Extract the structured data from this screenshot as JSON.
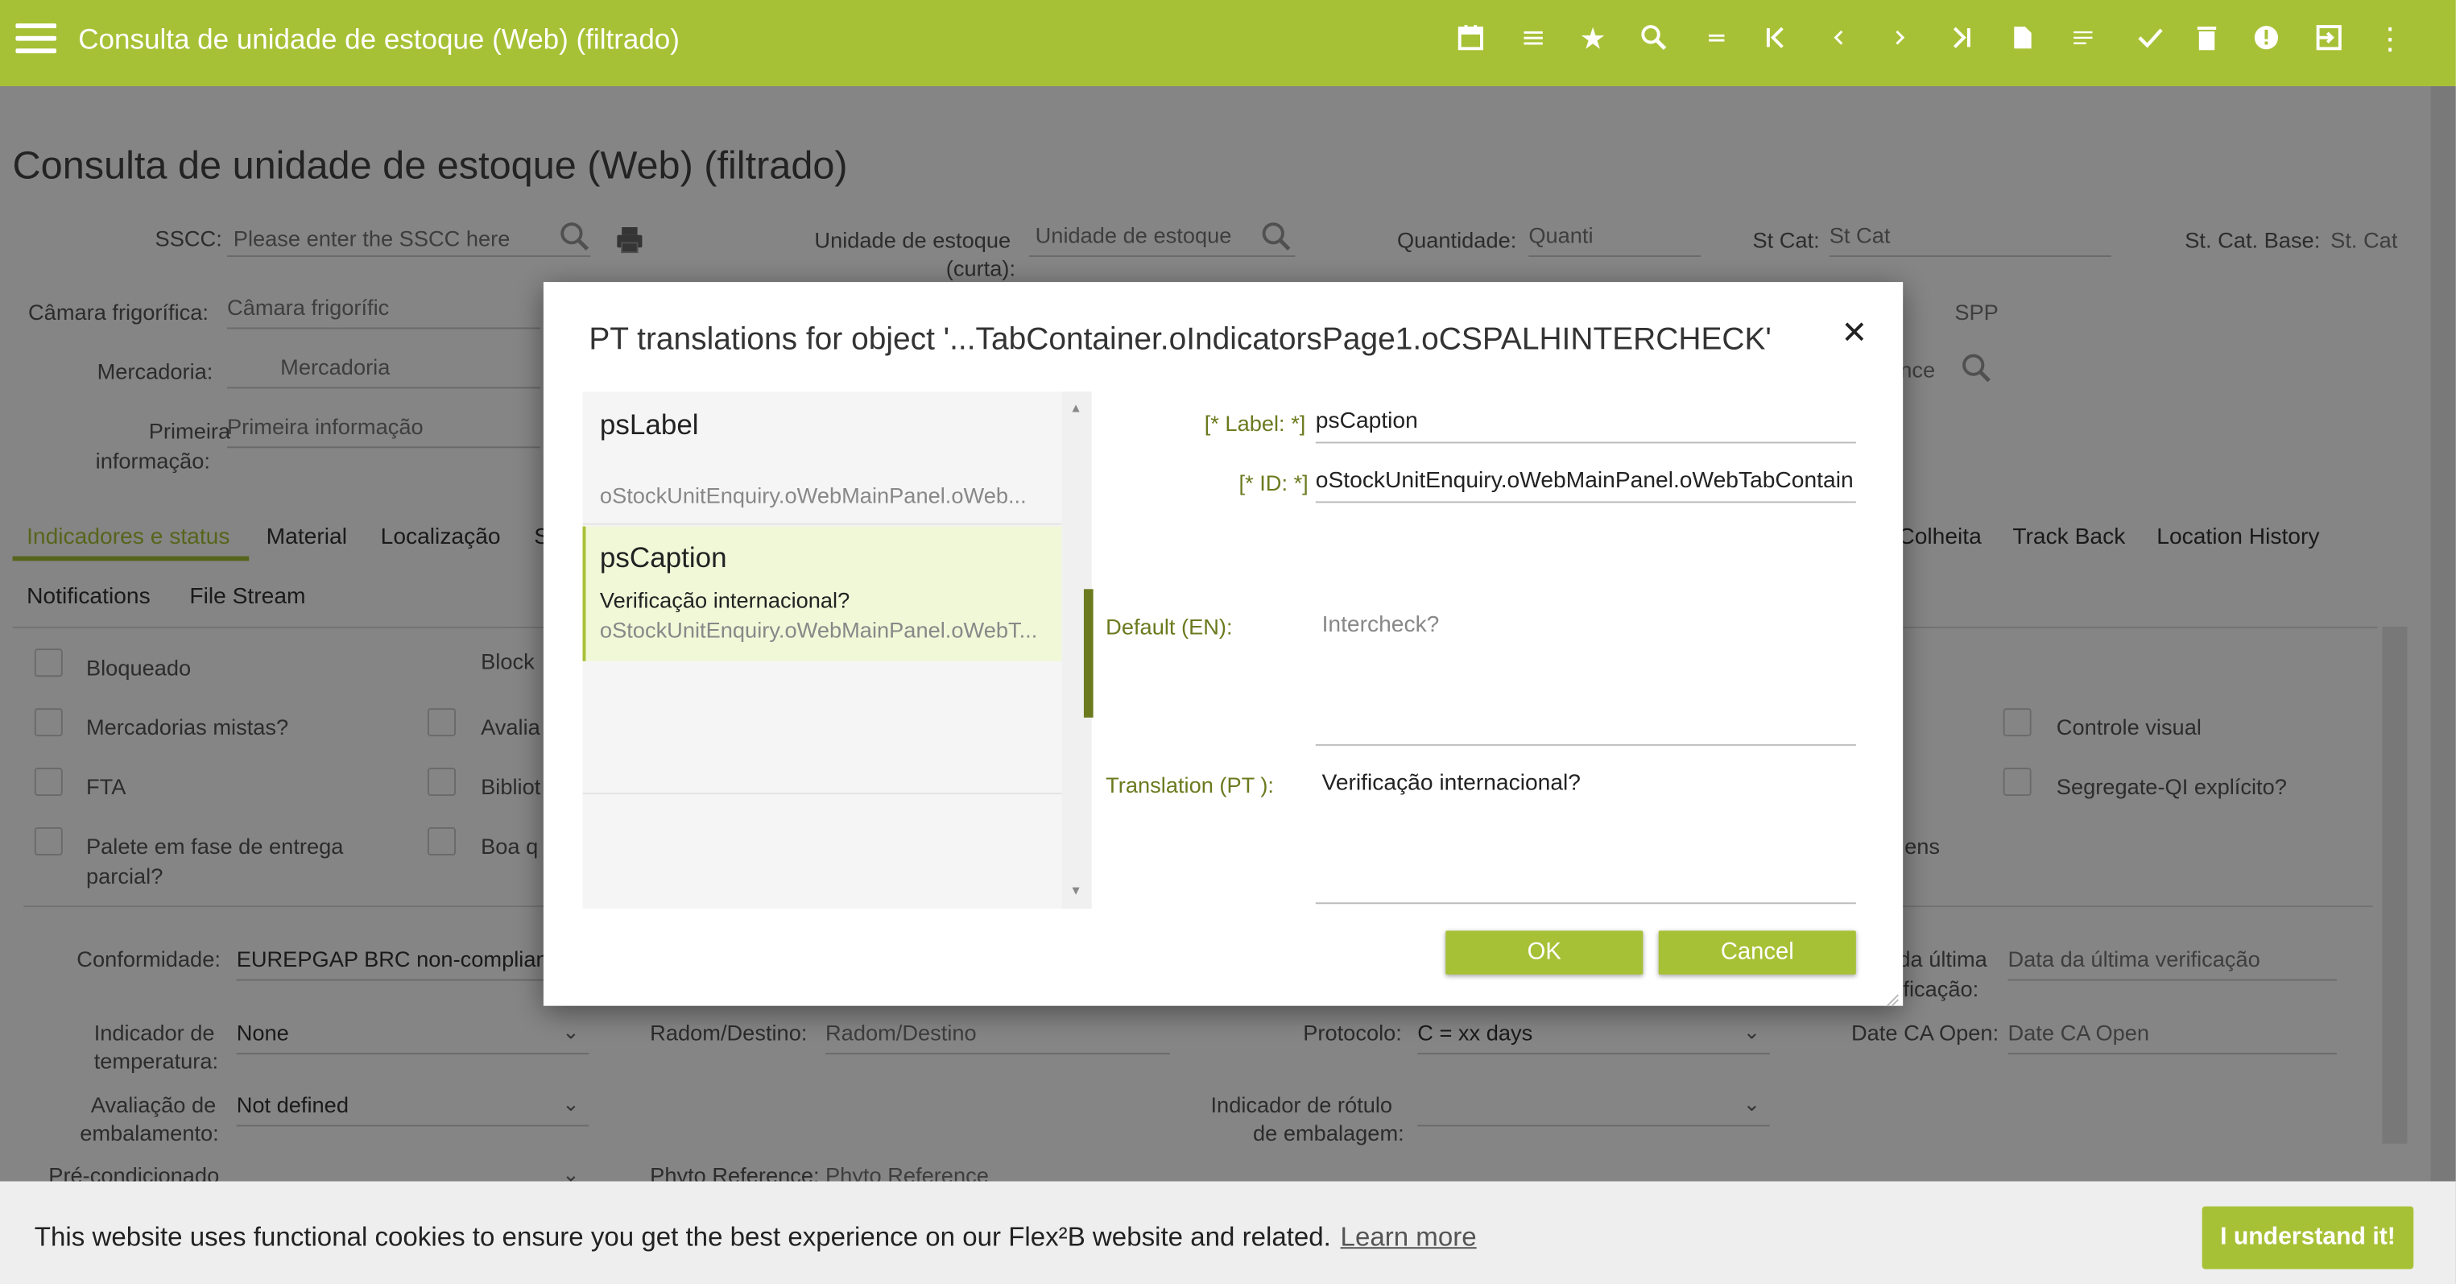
{
  "app": {
    "title": "Consulta de unidade de estoque (Web) (filtrado)"
  },
  "toolbar_icons": [
    "calendar-icon",
    "list-icon",
    "star-icon",
    "search-icon",
    "equals-icon",
    "first-page-icon",
    "prev-icon",
    "next-icon",
    "last-page-icon",
    "new-document-icon",
    "notes-icon",
    "check-icon",
    "delete-icon",
    "info-icon",
    "exit-icon",
    "more-vert-icon"
  ],
  "page": {
    "title": "Consulta de unidade de estoque (Web) (filtrado)",
    "sscc_label": "SSCC:",
    "sscc_placeholder": "Please enter the SSCC here",
    "unidade_label": "Unidade de estoque",
    "unidade_label2": "(curta):",
    "unidade_value": "Unidade de estoque",
    "quantidade_label": "Quantidade:",
    "quantidade_value": "Quanti",
    "stcat_label": "St Cat:",
    "stcat_value": "St Cat",
    "stcatbase_label": "St. Cat. Base:",
    "stcatbase_value": "St. Cat",
    "camara_label": "Câmara frigorífica:",
    "camara_value": "Câmara frigorífic",
    "spp_value": "SPP",
    "mercadoria_label": "Mercadoria:",
    "mercadoria_value": "Mercadoria",
    "nce_value": "nce",
    "primeira_label": "Primeira",
    "primeira_label2": "informação:",
    "primeira_value": "Primeira informação"
  },
  "tabs_row1": [
    "Indicadores e status",
    "Material",
    "Localização",
    "S",
    "Colheita",
    "Track Back",
    "Location History"
  ],
  "tabs_row2": [
    "Notifications",
    "File Stream"
  ],
  "checkboxes": {
    "bloqueado": "Bloqueado",
    "block": "Block",
    "mistas": "Mercadorias mistas?",
    "avalia": "Avalia",
    "controle": "Controle visual",
    "fta": "FTA",
    "bibliot": "Bibliot",
    "segregate": "Segregate-QI explícito?",
    "palete1": "Palete em fase de entrega",
    "palete2": "parcial?",
    "boa": "Boa q",
    "ens": "ens"
  },
  "fields": {
    "conformidade_label": "Conformidade:",
    "conformidade_value": "EUREPGAP BRC non-complian",
    "dataultima_label1": "da última",
    "dataultima_label2": "ificação:",
    "dataultima_value": "Data da última verificação",
    "indtemp_label1": "Indicador de",
    "indtemp_label2": "temperatura:",
    "indtemp_value": "None",
    "radom_label": "Radom/Destino:",
    "radom_value": "Radom/Destino",
    "protocolo_label": "Protocolo:",
    "protocolo_value": "C = xx days",
    "dateca_label": "Date CA Open:",
    "dateca_value": "Date CA Open",
    "avaliacao_label1": "Avaliação de",
    "avaliacao_label2": "embalamento:",
    "avaliacao_value": "Not defined",
    "rotulo_label1": "Indicador de rótulo",
    "rotulo_label2": "de embalagem:",
    "precond_label": "Pré-condicionado",
    "phyto_label": "Phyto Reference:",
    "phyto_value": "Phyto Reference"
  },
  "dialog": {
    "title": "PT translations for object '...TabContainer.oIndicatorsPage1.oCSPALHINTERCHECK'",
    "close_glyph": "✕",
    "items": [
      {
        "name": "psLabel",
        "translation": "",
        "path": "oStockUnitEnquiry.oWebMainPanel.oWeb..."
      },
      {
        "name": "psCaption",
        "translation": "Verificação internacional?",
        "path": "oStockUnitEnquiry.oWebMainPanel.oWebT..."
      }
    ],
    "label_field_label": "[* Label: *]",
    "label_field_value": "psCaption",
    "id_field_label": "[* ID: *]",
    "id_field_value": "oStockUnitEnquiry.oWebMainPanel.oWebTabContain",
    "default_label": "Default (EN):",
    "default_value": "Intercheck?",
    "translation_label": "Translation (PT ):",
    "translation_value": "Verificação internacional?",
    "ok_label": "OK",
    "cancel_label": "Cancel"
  },
  "cookie": {
    "text": "This website uses functional cookies to ensure you get the best experience on our Flex²B website and related.",
    "learn_more": "Learn more",
    "button": "I understand it!"
  },
  "colors": {
    "accent": "#a7c136",
    "label_green": "#6b7a1e"
  }
}
